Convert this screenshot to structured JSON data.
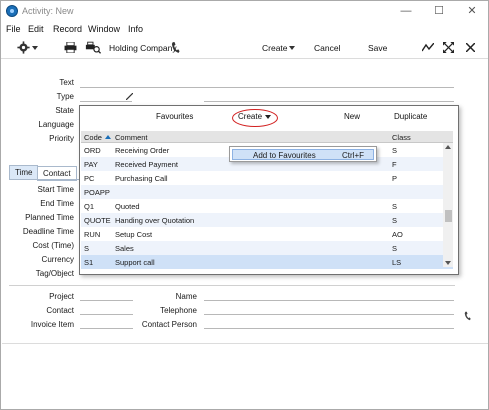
{
  "window": {
    "title": "Activity: New",
    "controls": [
      "minimize-icon",
      "maximize-icon",
      "close-icon"
    ]
  },
  "menubar": {
    "items": [
      "File",
      "Edit",
      "Record",
      "Window",
      "Info"
    ]
  },
  "toolbar": {
    "company": "Holding Company",
    "create": "Create",
    "cancel": "Cancel",
    "save": "Save",
    "icons": [
      "gear-icon",
      "printer-icon",
      "print-preview-icon",
      "phone-icon",
      "chevron-down-icon",
      "chart-icon",
      "expand-icon",
      "close-icon"
    ]
  },
  "form_top": {
    "labels": [
      "Text",
      "Type",
      "State",
      "Language",
      "Priority"
    ]
  },
  "tabs": {
    "time": "Time",
    "contact": "Contact"
  },
  "form_left": {
    "labels": [
      "Start Time",
      "End Time",
      "Planned Time",
      "Deadline Time",
      "Cost (Time)",
      "Currency",
      "Tag/Object"
    ]
  },
  "form_bottom": {
    "left_labels": [
      "Project",
      "Contact",
      "Invoice Item"
    ],
    "right_labels": [
      "Name",
      "Telephone",
      "Contact Person"
    ]
  },
  "popup": {
    "header": {
      "favourites": "Favourites",
      "create": "Create",
      "new": "New",
      "duplicate": "Duplicate"
    },
    "columns": {
      "code": "Code",
      "comment": "Comment",
      "class": "Class"
    },
    "rows": [
      {
        "code": "ORD",
        "comment": "Receiving Order",
        "class": "S"
      },
      {
        "code": "PAY",
        "comment": "Received Payment",
        "class": "F"
      },
      {
        "code": "PC",
        "comment": "Purchasing Call",
        "class": "P"
      },
      {
        "code": "POAPP",
        "comment": "",
        "class": ""
      },
      {
        "code": "Q1",
        "comment": "Quoted",
        "class": "S"
      },
      {
        "code": "QUOTE",
        "comment": "Handing over Quotation",
        "class": "S"
      },
      {
        "code": "RUN",
        "comment": "Setup Cost",
        "class": "AO"
      },
      {
        "code": "S",
        "comment": "Sales",
        "class": "S"
      },
      {
        "code": "S1",
        "comment": "Support call",
        "class": "LS"
      }
    ]
  },
  "context_menu": {
    "label": "Add to Favourites",
    "shortcut": "Ctrl+F"
  },
  "colors": {
    "selection": "#cfe1f7",
    "highlight_ring": "#d22020",
    "tab_active": "#dbe8f7"
  }
}
